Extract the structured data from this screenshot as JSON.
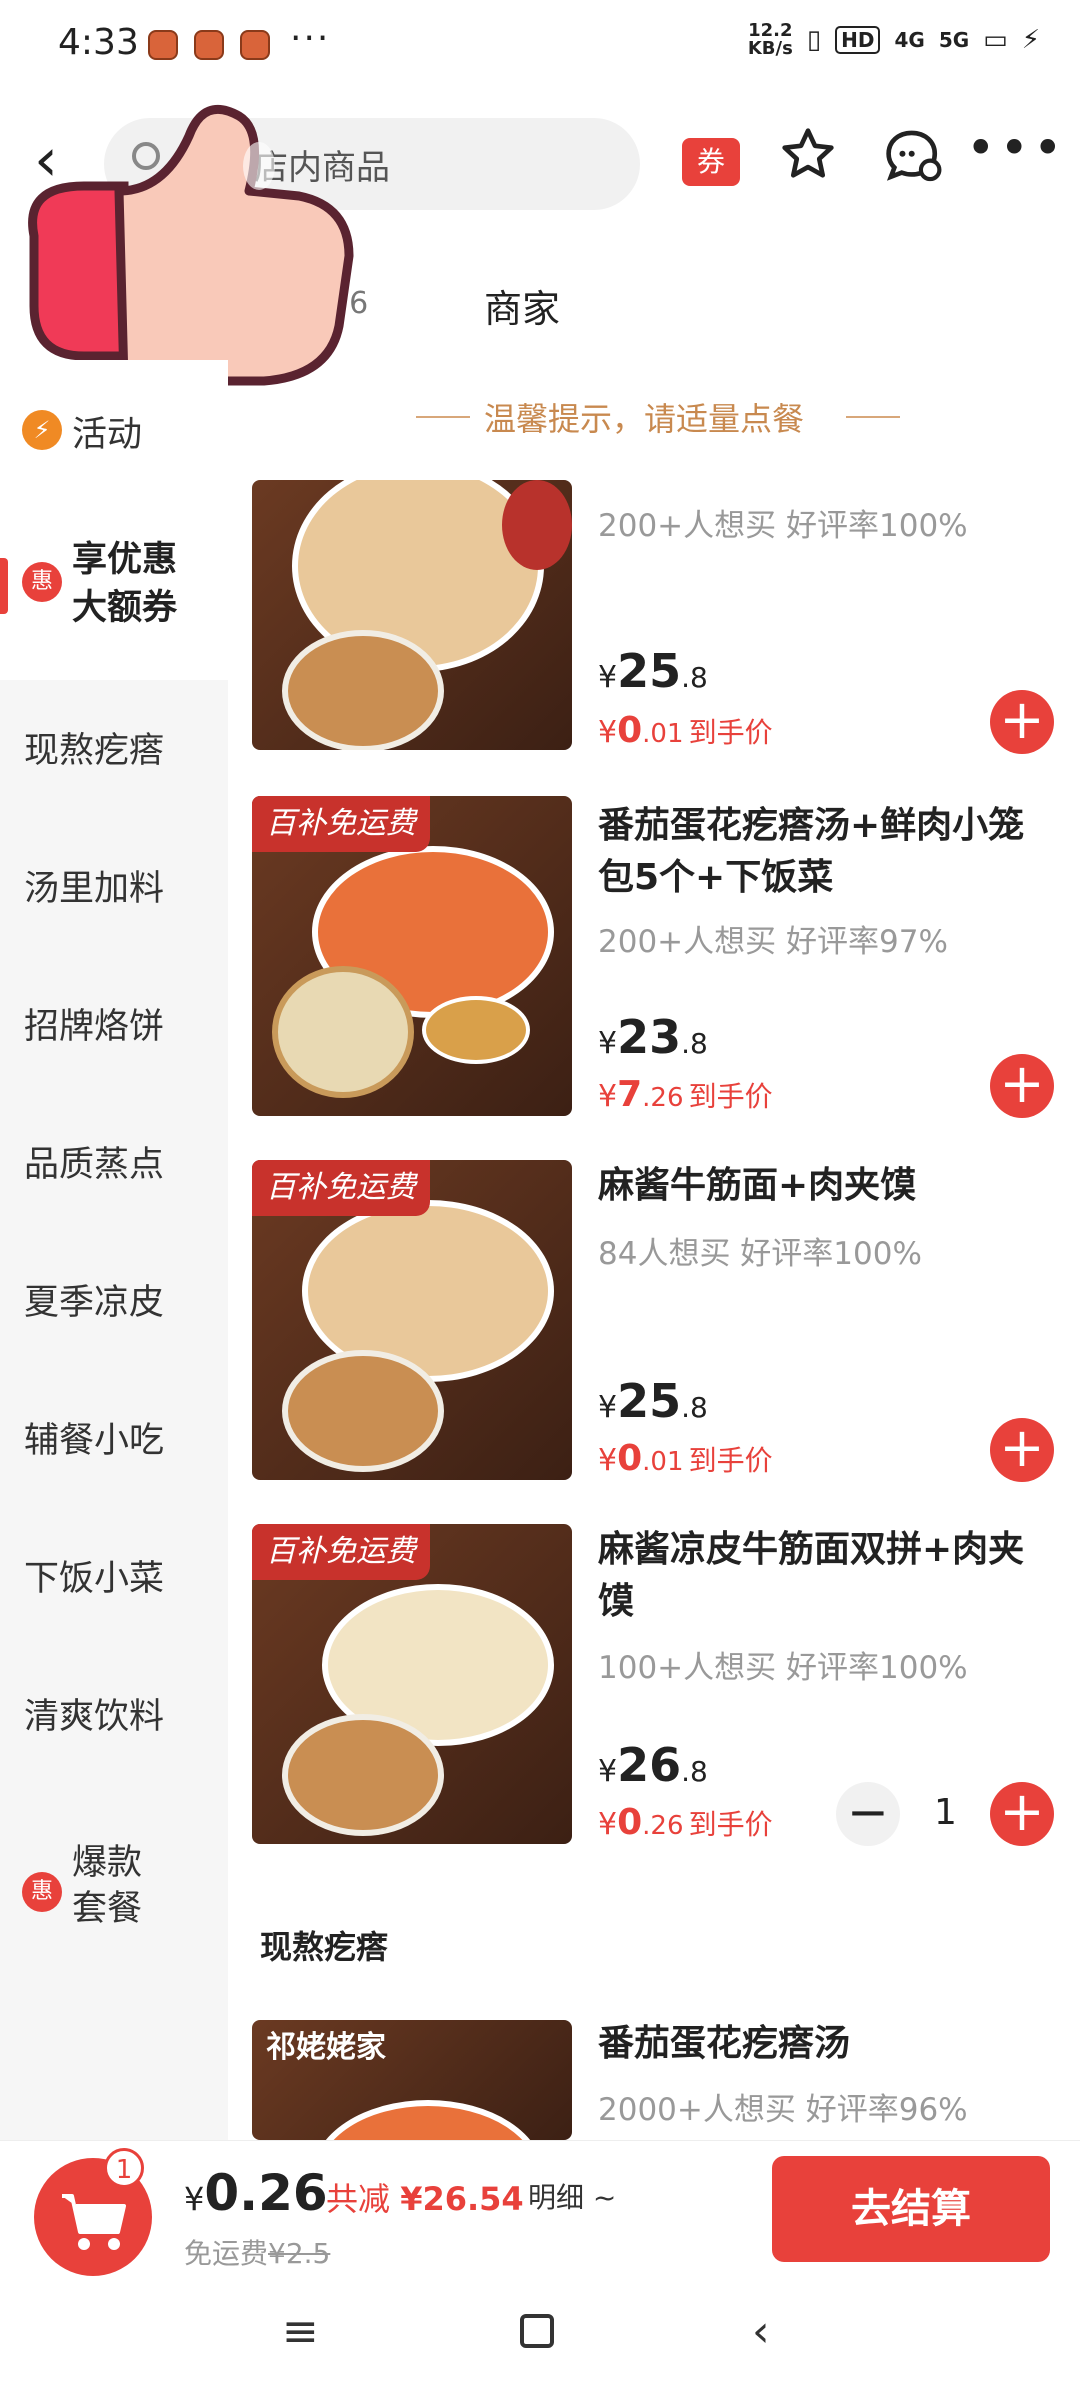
{
  "status_bar": {
    "time": "4:33",
    "dots": "···",
    "net_speed": "12.2\nKB/s",
    "hd": "HD",
    "net1": "4G",
    "net2": "5G"
  },
  "header": {
    "search_placeholder": "店内商品",
    "coupon_label": "券"
  },
  "tabs": {
    "count": "76",
    "merchant": "商家"
  },
  "sidebar": {
    "items": [
      {
        "label": "活动"
      },
      {
        "label": "享优惠大额券",
        "line1": "享优惠",
        "line2": "大额券",
        "badge": "惠"
      },
      {
        "label": "现熬疙瘩"
      },
      {
        "label": "汤里加料"
      },
      {
        "label": "招牌烙饼"
      },
      {
        "label": "品质蒸点"
      },
      {
        "label": "夏季凉皮"
      },
      {
        "label": "辅餐小吃"
      },
      {
        "label": "下饭小菜"
      },
      {
        "label": "清爽饮料"
      },
      {
        "label": "爆款套餐",
        "line1": "爆款",
        "line2": "套餐",
        "badge": "惠"
      }
    ]
  },
  "tip": "温馨提示，请适量点餐",
  "products": [
    {
      "name": "",
      "meta": "200+人想买 好评率100%",
      "price_int": "25",
      "price_dec": ".8",
      "final_int": "0",
      "final_dec": ".01",
      "final_label": "到手价",
      "badge": ""
    },
    {
      "name": "番茄蛋花疙瘩汤+鲜肉小笼包5个+下饭菜",
      "meta": "200+人想买 好评率97%",
      "price_int": "23",
      "price_dec": ".8",
      "final_int": "7",
      "final_dec": ".26",
      "final_label": "到手价",
      "badge": "百补免运费"
    },
    {
      "name": "麻酱牛筋面+肉夹馍",
      "meta": "84人想买 好评率100%",
      "price_int": "25",
      "price_dec": ".8",
      "final_int": "0",
      "final_dec": ".01",
      "final_label": "到手价",
      "badge": "百补免运费"
    },
    {
      "name": "麻酱凉皮牛筋面双拼+肉夹馍",
      "meta": "100+人想买 好评率100%",
      "price_int": "26",
      "price_dec": ".8",
      "final_int": "0",
      "final_dec": ".26",
      "final_label": "到手价",
      "badge": "百补免运费",
      "quantity": "1"
    }
  ],
  "section": {
    "title": "现熬疙瘩",
    "product": {
      "name": "番茄蛋花疙瘩汤",
      "meta": "2000+人想买 好评率96%",
      "badge": "祁姥姥家"
    }
  },
  "currency": "¥",
  "bottom_bar": {
    "cart_count": "1",
    "total": "0.26",
    "saved_label": "共减",
    "saved_amount": "¥26.54",
    "detail": "明细 ~",
    "free_ship_label": "免运费",
    "original_ship": "¥2.5",
    "checkout": "去结算"
  },
  "colors": {
    "accent": "#e8413b",
    "tip": "#c8894f",
    "sidebar_bg": "#f6f6f6"
  }
}
